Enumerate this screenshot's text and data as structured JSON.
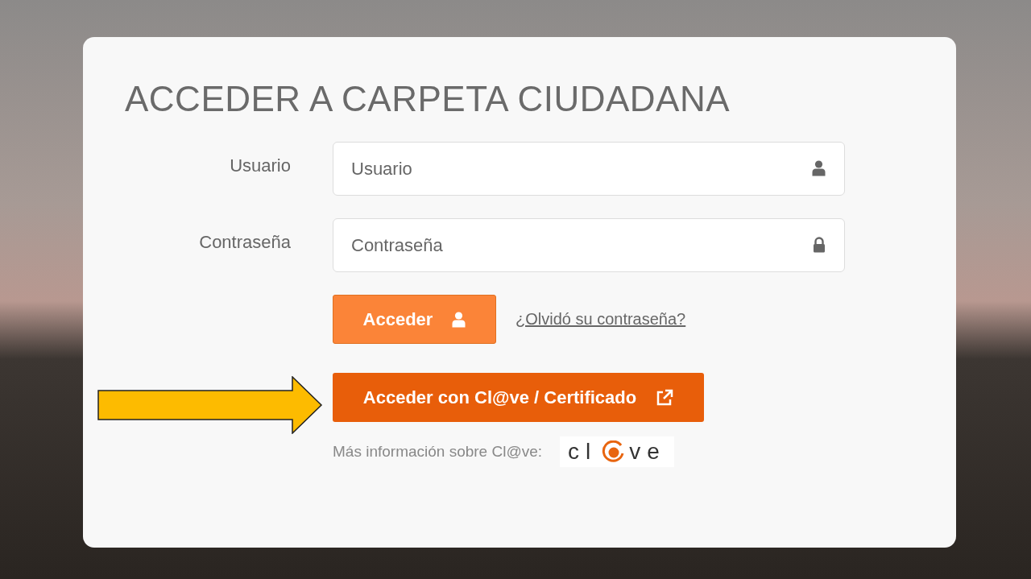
{
  "title": "ACCEDER A CARPETA CIUDADANA",
  "fields": [
    {
      "label": "Usuario",
      "placeholder": "Usuario",
      "kind": "user"
    },
    {
      "label": "Contraseña",
      "placeholder": "Contraseña",
      "kind": "password"
    }
  ],
  "login_button": "Acceder",
  "forgot_link": "¿Olvidó su contraseña?",
  "clave_button": "Acceder con Cl@ve / Certificado",
  "more_info": "Más información sobre Cl@ve:",
  "clave_logo": {
    "before": "cl",
    "after": "ve"
  }
}
